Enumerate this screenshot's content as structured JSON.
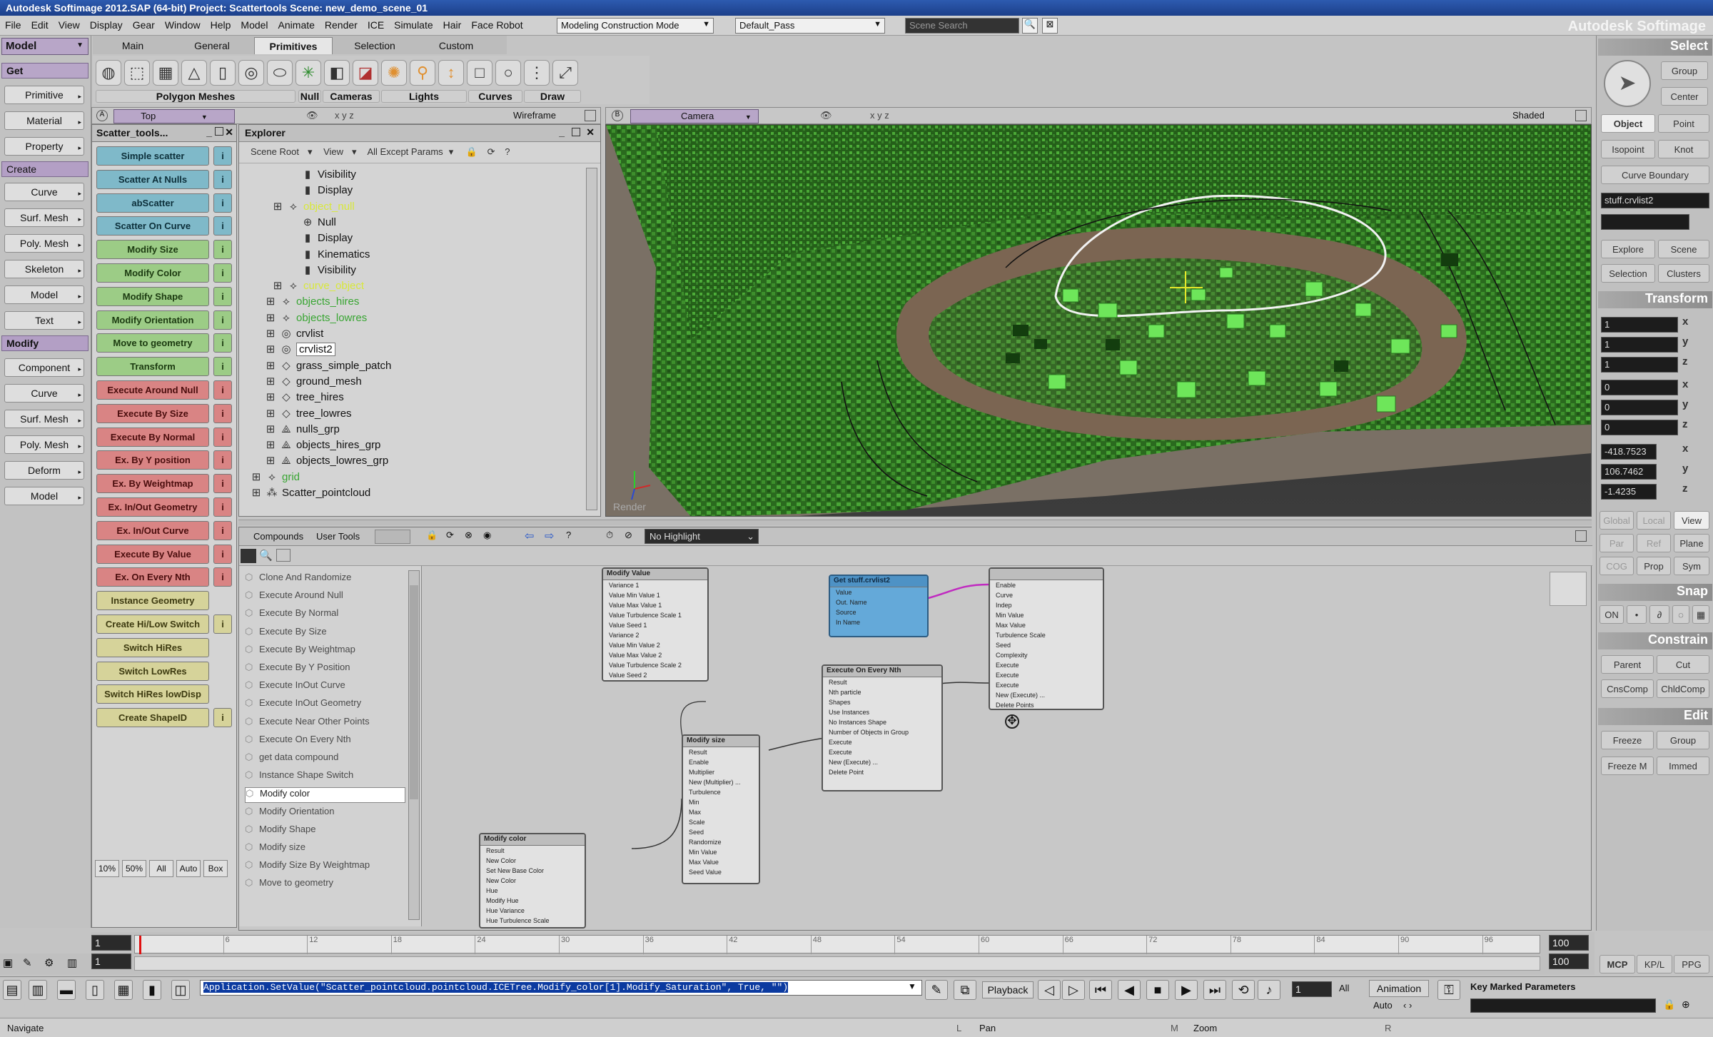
{
  "titlebar": {
    "text": "Autodesk Softimage 2012.SAP (64-bit)    Project: Scattertools    Scene: new_demo_scene_01"
  },
  "menubar": {
    "items": [
      "File",
      "Edit",
      "View",
      "Display",
      "Gear",
      "Window",
      "Help",
      "Model",
      "Animate",
      "Render",
      "ICE",
      "Simulate",
      "Hair",
      "Face Robot"
    ],
    "mode_combo": "Modeling Construction Mode",
    "pass_combo": "Default_Pass",
    "search_placeholder": "Scene Search",
    "brand": "Autodesk Softimage"
  },
  "left_toolbar": {
    "mode": "Model",
    "get_label": "Get",
    "create_label": "Create",
    "modify_label": "Modify",
    "get_items": [
      "Primitive",
      "Material",
      "Property"
    ],
    "create_items": [
      "Curve",
      "Surf. Mesh",
      "Poly. Mesh",
      "Skeleton",
      "Model",
      "Text"
    ],
    "modify_items": [
      "Component",
      "Curve",
      "Surf. Mesh",
      "Poly. Mesh",
      "Deform",
      "Model"
    ]
  },
  "tabs": [
    "Main",
    "General",
    "Primitives",
    "Selection",
    "Custom"
  ],
  "tool_groups": [
    "Polygon Meshes",
    "Null",
    "Cameras",
    "Lights",
    "Curves",
    "Draw"
  ],
  "scatter_panel": {
    "title": "Scatter_tools...",
    "buttons": [
      {
        "label": "Simple scatter",
        "color": "cyan"
      },
      {
        "label": "Scatter At Nulls",
        "color": "cyan"
      },
      {
        "label": "abScatter",
        "color": "cyan"
      },
      {
        "label": "Scatter On Curve",
        "color": "cyan"
      },
      {
        "label": "Modify Size",
        "color": "green"
      },
      {
        "label": "Modify Color",
        "color": "green"
      },
      {
        "label": "Modify Shape",
        "color": "green"
      },
      {
        "label": "Modify Orientation",
        "color": "green"
      },
      {
        "label": "Move to geometry",
        "color": "green"
      },
      {
        "label": "Transform",
        "color": "green"
      },
      {
        "label": "Execute Around Null",
        "color": "red"
      },
      {
        "label": "Execute By Size",
        "color": "red"
      },
      {
        "label": "Execute By Normal",
        "color": "red"
      },
      {
        "label": "Ex. By Y position",
        "color": "red"
      },
      {
        "label": "Ex. By Weightmap",
        "color": "red"
      },
      {
        "label": "Ex. In/Out Geometry",
        "color": "red"
      },
      {
        "label": "Ex. In/Out Curve",
        "color": "red"
      },
      {
        "label": "Execute By Value",
        "color": "red"
      },
      {
        "label": "Ex. On Every Nth",
        "color": "red"
      },
      {
        "label": "Instance Geometry",
        "color": "yel"
      },
      {
        "label": "Create Hi/Low Switch",
        "color": "yel"
      },
      {
        "label": "Switch HiRes",
        "color": "yel"
      },
      {
        "label": "Switch LowRes",
        "color": "yel"
      },
      {
        "label": "Switch HiRes lowDisp",
        "color": "yel"
      },
      {
        "label": "Create ShapeID",
        "color": "yel"
      }
    ],
    "info_label": "i",
    "bottom": [
      "10%",
      "50%",
      "All",
      "Auto",
      "Box"
    ]
  },
  "top_viewport": {
    "label": "Top",
    "mode": "Wireframe"
  },
  "explorer": {
    "title": "Explorer",
    "filters": [
      "Scene Root",
      "View",
      "All Except Params"
    ],
    "tree": [
      {
        "label": "Visibility",
        "style": "",
        "icon": "▮"
      },
      {
        "label": "Display",
        "style": "",
        "icon": "▮"
      },
      {
        "label": "object_null",
        "style": "ylw",
        "icon": "⟡"
      },
      {
        "label": "Null",
        "style": "",
        "icon": "⊕"
      },
      {
        "label": "Display",
        "style": "",
        "icon": "▮"
      },
      {
        "label": "Kinematics",
        "style": "",
        "icon": "▮"
      },
      {
        "label": "Visibility",
        "style": "",
        "icon": "▮"
      },
      {
        "label": "curve_object",
        "style": "ylw",
        "icon": "⟡"
      },
      {
        "label": "objects_hires",
        "style": "grn",
        "icon": "⟡"
      },
      {
        "label": "objects_lowres",
        "style": "grn",
        "icon": "⟡"
      },
      {
        "label": "crvlist",
        "style": "",
        "icon": "◎"
      },
      {
        "label": "crvlist2",
        "style": "sel",
        "icon": "◎"
      },
      {
        "label": "grass_simple_patch",
        "style": "",
        "icon": "◇"
      },
      {
        "label": "ground_mesh",
        "style": "",
        "icon": "◇"
      },
      {
        "label": "tree_hires",
        "style": "",
        "icon": "◇"
      },
      {
        "label": "tree_lowres",
        "style": "",
        "icon": "◇"
      },
      {
        "label": "nulls_grp",
        "style": "",
        "icon": "⟁"
      },
      {
        "label": "objects_hires_grp",
        "style": "",
        "icon": "⟁"
      },
      {
        "label": "objects_lowres_grp",
        "style": "",
        "icon": "⟁"
      },
      {
        "label": "grid",
        "style": "grn",
        "icon": "⟡"
      },
      {
        "label": "Scatter_pointcloud",
        "style": "",
        "icon": "⁂"
      }
    ]
  },
  "camera_viewport": {
    "label": "Camera",
    "mode": "Shaded",
    "overlay": "Render"
  },
  "ice_tree": {
    "tabs": [
      "Compounds",
      "User Tools"
    ],
    "highlight_combo": "No Highlight",
    "list": [
      "Clone And Randomize",
      "Execute Around Null",
      "Execute By Normal",
      "Execute By Size",
      "Execute By Weightmap",
      "Execute By Y Position",
      "Execute InOut Curve",
      "Execute InOut Geometry",
      "Execute Near Other Points",
      "Execute On Every Nth",
      "get data compound",
      "Instance Shape Switch",
      "Modify color",
      "Modify Orientation",
      "Modify Shape",
      "Modify size",
      "Modify Size By Weightmap",
      "Move to geometry"
    ],
    "selected_item": "Modify color",
    "nodes": {
      "modify_value": {
        "title": "Modify Value",
        "ports": [
          "Variance 1",
          "Value Min Value 1",
          "Value Max Value 1",
          "Value Turbulence Scale 1",
          "Value Seed 1",
          "Variance 2",
          "Value Min Value 2",
          "Value Max Value 2",
          "Value Turbulence Scale 2",
          "Value Seed 2"
        ]
      },
      "get_data": {
        "title": "Get stuff.crvlist2",
        "ports": [
          "Value",
          "Out. Name",
          "Source",
          "In Name"
        ]
      },
      "right_node": {
        "title": "",
        "ports": [
          "Enable",
          "Curve",
          "Indep",
          "Min Value",
          "Max Value",
          "Turbulence Scale",
          "Seed",
          "Complexity",
          "Execute",
          "Execute",
          "Execute",
          "New (Execute) ...",
          "Delete Points"
        ]
      },
      "execute_nth": {
        "title": "Execute On Every Nth",
        "ports": [
          "Result",
          "Nth particle",
          "Shapes",
          "Use Instances",
          "No Instances Shape",
          "Number of Objects in Group",
          "Execute",
          "Execute",
          "New (Execute) ...",
          "Delete Point"
        ]
      },
      "modify_size": {
        "title": "Modify size",
        "ports": [
          "Result",
          "Enable",
          "Multiplier",
          "New (Multiplier) ...",
          "Turbulence",
          "Min",
          "Max",
          "Scale",
          "Seed",
          "Randomize",
          "Min Value",
          "Max Value",
          "Seed Value"
        ]
      },
      "modify_color": {
        "title": "Modify color",
        "ports": [
          "Result",
          "New Color",
          "Set New Base Color",
          "New Color",
          "Hue",
          "Modify Hue",
          "Hue Variance",
          "Hue Turbulence Scale"
        ]
      }
    }
  },
  "right_panel": {
    "select_header": "Select",
    "select_buttons": [
      "Group",
      "Center",
      "Object",
      "Point",
      "Isopoint",
      "Knot",
      "Curve Boundary"
    ],
    "name_field": "stuff.crvlist2",
    "explore_buttons": [
      "Explore",
      "Scene",
      "Selection",
      "Clusters"
    ],
    "transform_header": "Transform",
    "scale": [
      "1",
      "1",
      "1"
    ],
    "rotate": [
      "0",
      "0",
      "0"
    ],
    "translate": [
      "-418.7523",
      "106.7462",
      "-1.4235"
    ],
    "axes": [
      "x",
      "y",
      "z"
    ],
    "transform_modes": [
      "Global",
      "Local",
      "View",
      "Par",
      "Ref",
      "Plane",
      "COG",
      "Prop",
      "Sym"
    ],
    "snap_header": "Snap",
    "snap_on": "ON",
    "constrain_header": "Constrain",
    "constrain_buttons": [
      "Parent",
      "Cut",
      "CnsComp",
      "ChldComp"
    ],
    "edit_header": "Edit",
    "edit_buttons": [
      "Freeze",
      "Group",
      "Freeze M",
      "Immed"
    ],
    "bottom_tabs": [
      "MCP",
      "KP/L",
      "PPG"
    ]
  },
  "timeline": {
    "start": "1",
    "current": "1",
    "end": "100",
    "end2": "100",
    "ticks": [
      "6",
      "12",
      "18",
      "24",
      "30",
      "36",
      "42",
      "48",
      "54",
      "60",
      "66",
      "72",
      "78",
      "84",
      "90",
      "96"
    ]
  },
  "command_line": {
    "text": "Application.SetValue(\"Scatter_pointcloud.pointcloud.ICETree.Modify_color[1].Modify_Saturation\", True, \"\")"
  },
  "playback": {
    "label": "Playback",
    "frame": "1",
    "all_label": "All",
    "animation_label": "Animation",
    "auto_label": "Auto",
    "key_label": "Key Marked Parameters"
  },
  "statusbar": {
    "left": "Navigate",
    "mid1_key": "L",
    "mid1": "Pan",
    "mid2_key": "M",
    "mid2": "Zoom",
    "mid3_key": "R"
  },
  "colors": {
    "purple": "#b8a6c8",
    "cyan": "#7fb9c9",
    "green": "#9ccc86",
    "red": "#d98484",
    "yellow": "#d6d39a",
    "node_blue": "#64a9d9",
    "grass": "#3a8a2a"
  }
}
